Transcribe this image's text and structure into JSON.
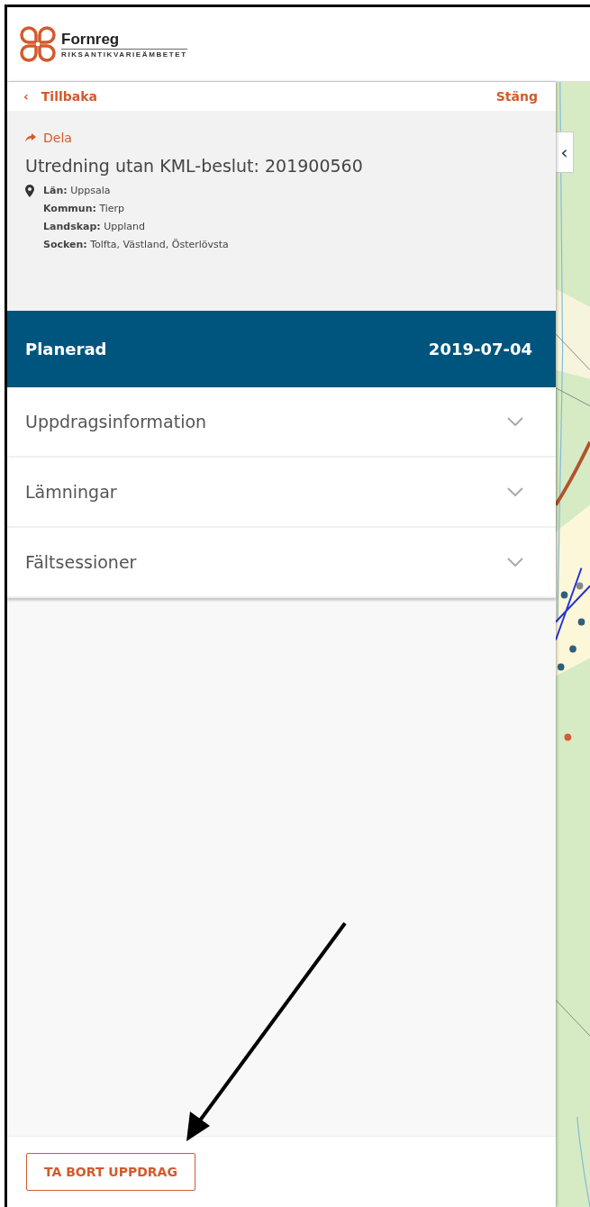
{
  "header": {
    "logo_name": "Fornreg",
    "logo_subtitle": "RIKSANTIKVARIEÄMBETET"
  },
  "nav": {
    "back": "Tillbaka",
    "back_icon": "‹",
    "close": "Stäng"
  },
  "details": {
    "share": "Dela",
    "title": "Utredning utan KML-beslut: 201900560",
    "fields": [
      {
        "label": "Län:",
        "value": "Uppsala"
      },
      {
        "label": "Kommun:",
        "value": "Tierp"
      },
      {
        "label": "Landskap:",
        "value": "Uppland"
      },
      {
        "label": "Socken:",
        "value": "Tolfta, Västland, Österlövsta"
      }
    ]
  },
  "status": {
    "label": "Planerad",
    "date": "2019-07-04"
  },
  "sections": [
    {
      "label": "Uppdragsinformation",
      "expanded": false
    },
    {
      "label": "Lämningar",
      "expanded": false
    },
    {
      "label": "Fältsessioner",
      "expanded": false
    }
  ],
  "footer": {
    "button": "TA BORT UPPDRAG"
  },
  "map": {
    "kind": "picture",
    "collapse_icon": "‹"
  }
}
